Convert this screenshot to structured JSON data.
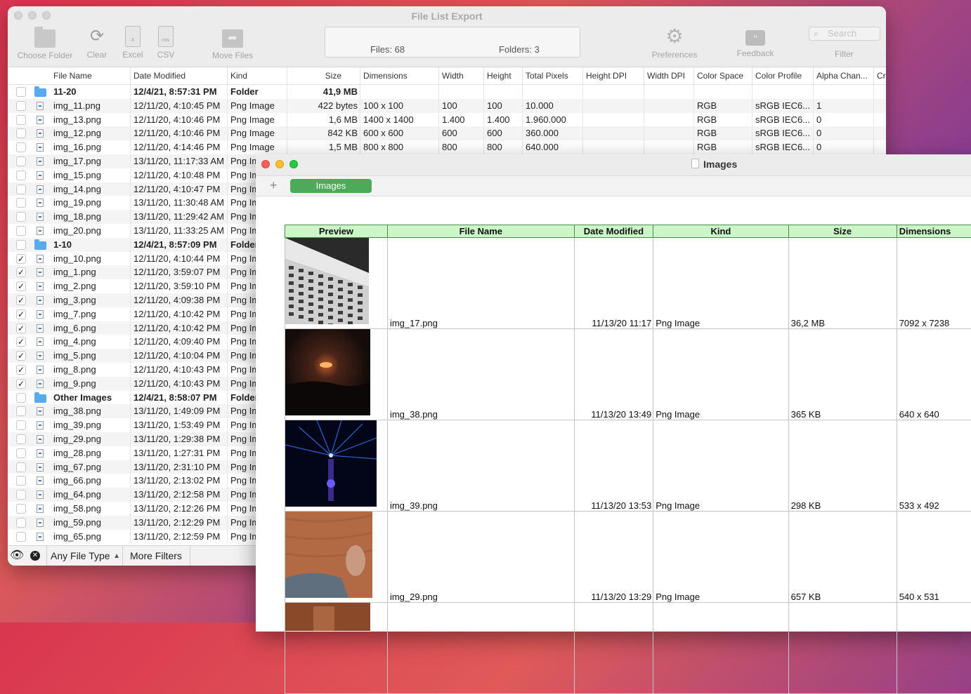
{
  "main_window": {
    "title": "File List Export",
    "toolbar": {
      "choose_folder": "Choose Folder",
      "clear": "Clear",
      "excel": "Excel",
      "csv": "CSV",
      "move_files": "Move Files",
      "preferences": "Preferences",
      "feedback": "Feedback",
      "filter": "Filter",
      "search_placeholder": "Search",
      "files_count": "Files: 68",
      "folders_count": "Folders: 3"
    },
    "columns": [
      "File Name",
      "Date Modified",
      "Kind",
      "Size",
      "Dimensions",
      "Width",
      "Height",
      "Total Pixels",
      "Height DPI",
      "Width DPI",
      "Color Space",
      "Color Profile",
      "Alpha Chan...",
      "Cr"
    ],
    "rows": [
      {
        "type": "folder",
        "checked": false,
        "name": "11-20",
        "date": "12/4/21, 8:57:31 PM",
        "kind": "Folder",
        "size": "41,9 MB",
        "dim": "",
        "w": "",
        "h": "",
        "px": "",
        "space": "",
        "profile": "",
        "alpha": ""
      },
      {
        "type": "file",
        "checked": false,
        "name": "img_11.png",
        "date": "12/11/20, 4:10:45 PM",
        "kind": "Png Image",
        "size": "422 bytes",
        "dim": "100 x 100",
        "w": "100",
        "h": "100",
        "px": "10.000",
        "space": "RGB",
        "profile": "sRGB IEC6...",
        "alpha": "1"
      },
      {
        "type": "file",
        "checked": false,
        "name": "img_13.png",
        "date": "12/11/20, 4:10:46 PM",
        "kind": "Png Image",
        "size": "1,6 MB",
        "dim": "1400 x 1400",
        "w": "1.400",
        "h": "1.400",
        "px": "1.960.000",
        "space": "RGB",
        "profile": "sRGB IEC6...",
        "alpha": "0"
      },
      {
        "type": "file",
        "checked": false,
        "name": "img_12.png",
        "date": "12/11/20, 4:10:46 PM",
        "kind": "Png Image",
        "size": "842 KB",
        "dim": "600 x 600",
        "w": "600",
        "h": "600",
        "px": "360.000",
        "space": "RGB",
        "profile": "sRGB IEC6...",
        "alpha": "0"
      },
      {
        "type": "file",
        "checked": false,
        "name": "img_16.png",
        "date": "12/11/20, 4:14:46 PM",
        "kind": "Png Image",
        "size": "1,5 MB",
        "dim": "800 x 800",
        "w": "800",
        "h": "800",
        "px": "640.000",
        "space": "RGB",
        "profile": "sRGB IEC6...",
        "alpha": "0"
      },
      {
        "type": "file",
        "checked": false,
        "name": "img_17.png",
        "date": "13/11/20, 11:17:33 AM",
        "kind": "Png Im"
      },
      {
        "type": "file",
        "checked": false,
        "name": "img_15.png",
        "date": "12/11/20, 4:10:48 PM",
        "kind": "Png Im"
      },
      {
        "type": "file",
        "checked": false,
        "name": "img_14.png",
        "date": "12/11/20, 4:10:47 PM",
        "kind": "Png Im"
      },
      {
        "type": "file",
        "checked": false,
        "name": "img_19.png",
        "date": "13/11/20, 11:30:48 AM",
        "kind": "Png Im"
      },
      {
        "type": "file",
        "checked": false,
        "name": "img_18.png",
        "date": "13/11/20, 11:29:42 AM",
        "kind": "Png Im"
      },
      {
        "type": "file",
        "checked": false,
        "name": "img_20.png",
        "date": "13/11/20, 11:33:25 AM",
        "kind": "Png Im"
      },
      {
        "type": "folder",
        "checked": false,
        "name": "1-10",
        "date": "12/4/21, 8:57:09 PM",
        "kind": "Folder"
      },
      {
        "type": "file",
        "checked": true,
        "name": "img_10.png",
        "date": "12/11/20, 4:10:44 PM",
        "kind": "Png Im"
      },
      {
        "type": "file",
        "checked": true,
        "name": "img_1.png",
        "date": "12/11/20, 3:59:07 PM",
        "kind": "Png Im"
      },
      {
        "type": "file",
        "checked": true,
        "name": "img_2.png",
        "date": "12/11/20, 3:59:10 PM",
        "kind": "Png Im"
      },
      {
        "type": "file",
        "checked": true,
        "name": "img_3.png",
        "date": "12/11/20, 4:09:38 PM",
        "kind": "Png Im"
      },
      {
        "type": "file",
        "checked": true,
        "name": "img_7.png",
        "date": "12/11/20, 4:10:42 PM",
        "kind": "Png Im"
      },
      {
        "type": "file",
        "checked": true,
        "name": "img_6.png",
        "date": "12/11/20, 4:10:42 PM",
        "kind": "Png Im"
      },
      {
        "type": "file",
        "checked": true,
        "name": "img_4.png",
        "date": "12/11/20, 4:09:40 PM",
        "kind": "Png Im"
      },
      {
        "type": "file",
        "checked": true,
        "name": "img_5.png",
        "date": "12/11/20, 4:10:04 PM",
        "kind": "Png Im"
      },
      {
        "type": "file",
        "checked": true,
        "name": "img_8.png",
        "date": "12/11/20, 4:10:43 PM",
        "kind": "Png Im"
      },
      {
        "type": "file",
        "checked": true,
        "name": "img_9.png",
        "date": "12/11/20, 4:10:43 PM",
        "kind": "Png Im"
      },
      {
        "type": "folder",
        "checked": false,
        "name": "Other Images",
        "date": "12/4/21, 8:58:07 PM",
        "kind": "Folder"
      },
      {
        "type": "file",
        "checked": false,
        "name": "img_38.png",
        "date": "13/11/20, 1:49:09 PM",
        "kind": "Png Im"
      },
      {
        "type": "file",
        "checked": false,
        "name": "img_39.png",
        "date": "13/11/20, 1:53:49 PM",
        "kind": "Png Im"
      },
      {
        "type": "file",
        "checked": false,
        "name": "img_29.png",
        "date": "13/11/20, 1:29:38 PM",
        "kind": "Png Im"
      },
      {
        "type": "file",
        "checked": false,
        "name": "img_28.png",
        "date": "13/11/20, 1:27:31 PM",
        "kind": "Png Im"
      },
      {
        "type": "file",
        "checked": false,
        "name": "img_67.png",
        "date": "13/11/20, 2:31:10 PM",
        "kind": "Png Im"
      },
      {
        "type": "file",
        "checked": false,
        "name": "img_66.png",
        "date": "13/11/20, 2:13:02 PM",
        "kind": "Png Im"
      },
      {
        "type": "file",
        "checked": false,
        "name": "img_64.png",
        "date": "13/11/20, 2:12:58 PM",
        "kind": "Png Im"
      },
      {
        "type": "file",
        "checked": false,
        "name": "img_58.png",
        "date": "13/11/20, 2:12:26 PM",
        "kind": "Png Im"
      },
      {
        "type": "file",
        "checked": false,
        "name": "img_59.png",
        "date": "13/11/20, 2:12:29 PM",
        "kind": "Png Im"
      },
      {
        "type": "file",
        "checked": false,
        "name": "img_65.png",
        "date": "13/11/20, 2:12:59 PM",
        "kind": "Png Im"
      }
    ],
    "bottom_bar": {
      "file_type": "Any File Type",
      "more_filters": "More Filters"
    }
  },
  "images_window": {
    "title": "Images",
    "sheet_tab": "Images",
    "columns": [
      "Preview",
      "File Name",
      "Date Modified",
      "Kind",
      "Size",
      "Dimensions"
    ],
    "rows": [
      {
        "thumb": "building-photo",
        "name": "img_17.png",
        "date": "11/13/20 11:17",
        "kind": "Png Image",
        "size": "36,2 MB",
        "dim": "7092 x 7238"
      },
      {
        "thumb": "sunset-photo",
        "name": "img_38.png",
        "date": "11/13/20 13:49",
        "kind": "Png Image",
        "size": "365 KB",
        "dim": "640 x 640"
      },
      {
        "thumb": "tower-light-photo",
        "name": "img_39.png",
        "date": "11/13/20 13:53",
        "kind": "Png Image",
        "size": "298 KB",
        "dim": "533 x 492"
      },
      {
        "thumb": "sand-hand-photo",
        "name": "img_29.png",
        "date": "11/13/20 13:29",
        "kind": "Png Image",
        "size": "657 KB",
        "dim": "540 x 531"
      }
    ]
  }
}
